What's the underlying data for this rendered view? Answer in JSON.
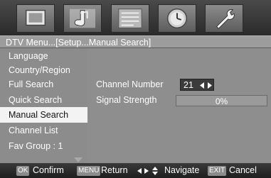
{
  "tabs": [
    {
      "name": "picture-icon"
    },
    {
      "name": "audio-note-icon"
    },
    {
      "name": "setup-list-icon",
      "active": true
    },
    {
      "name": "clock-icon"
    },
    {
      "name": "wrench-icon"
    }
  ],
  "title": "DTV Menu...[Setup...Manual Search]",
  "menu": {
    "items": [
      {
        "label": "Language"
      },
      {
        "label": "Country/Region"
      },
      {
        "label": "Full Search"
      },
      {
        "label": "Quick Search"
      },
      {
        "label": "Manual Search",
        "selected": true
      },
      {
        "label": "Channel List"
      },
      {
        "label": "Fav Group : 1"
      }
    ]
  },
  "panel": {
    "channel_number_label": "Channel Number",
    "channel_number_value": "21",
    "signal_strength_label": "Signal Strength",
    "signal_strength_value": "0%"
  },
  "footer": {
    "ok_key": "OK",
    "ok_label": "Confirm",
    "menu_key": "MENU",
    "menu_label": "Return",
    "navigate_label": "Navigate",
    "exit_key": "EXIT",
    "exit_label": "Cancel"
  },
  "colors": {
    "background": "#8a8a8a",
    "selected_item": "#f3f3f3",
    "footer": "#2a2a2a"
  }
}
